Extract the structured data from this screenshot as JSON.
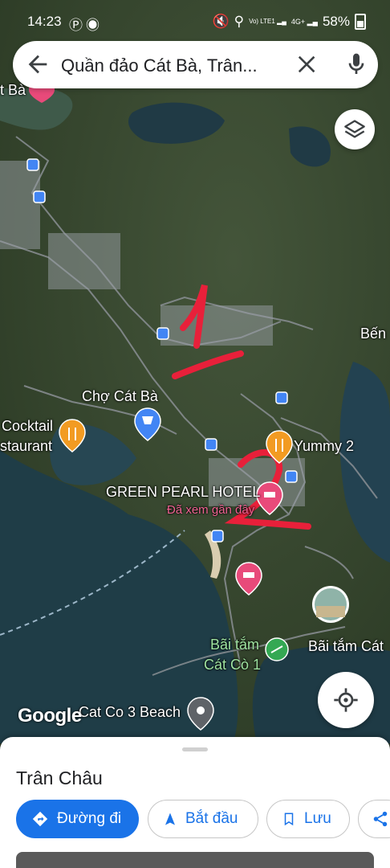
{
  "status_bar": {
    "time": "14:23",
    "battery": "58%",
    "left_icons": [
      "pinterest-icon",
      "messenger-icon"
    ],
    "right_icons": [
      "mute-icon",
      "location-icon",
      "lte-signal-icon",
      "4g-signal-icon",
      "battery-icon"
    ],
    "net_labels": [
      "Vo) LTE1",
      "4G+"
    ]
  },
  "search": {
    "query": "Quần đảo Cát Bà, Trân...",
    "back_icon": "arrow-left-icon",
    "clear_icon": "close-icon",
    "mic_icon": "mic-icon"
  },
  "map": {
    "labels": {
      "cat_ba_top": "t Bà",
      "ben": "Bến",
      "cho_cat_ba": "Chợ Cát Bà",
      "cocktail_1": "Cocktail",
      "cocktail_2": "staurant",
      "yummy": "Yummy 2",
      "green_pearl": "GREEN PEARL HOTEL",
      "recent": "Đã xem gần đây",
      "bai_tam_1": "Bãi tắm",
      "bai_tam_2": "Cát Cò 1",
      "bai_tam_right": "Bãi tắm Cát",
      "cat_co_3": "Cat Co 3 Beach",
      "google": "Google"
    },
    "annotations": [
      "1",
      "2"
    ],
    "colors": {
      "water": "#1f3d47",
      "land": "#3b4a2f",
      "road": "#8a8f94",
      "annotation": "#e8203a",
      "pin_pink": "#e84a7a",
      "pin_orange": "#f29b22",
      "pin_blue": "#4285f4"
    }
  },
  "controls": {
    "layers_icon": "layers-icon",
    "locate_icon": "my-location-icon"
  },
  "sheet": {
    "title": "Trân Châu",
    "buttons": [
      {
        "label": "Đường đi",
        "icon": "directions-icon"
      },
      {
        "label": "Bắt đầu",
        "icon": "navigation-arrow-icon"
      },
      {
        "label": "Lưu",
        "icon": "bookmark-icon"
      },
      {
        "label": "",
        "icon": "share-icon"
      }
    ]
  }
}
